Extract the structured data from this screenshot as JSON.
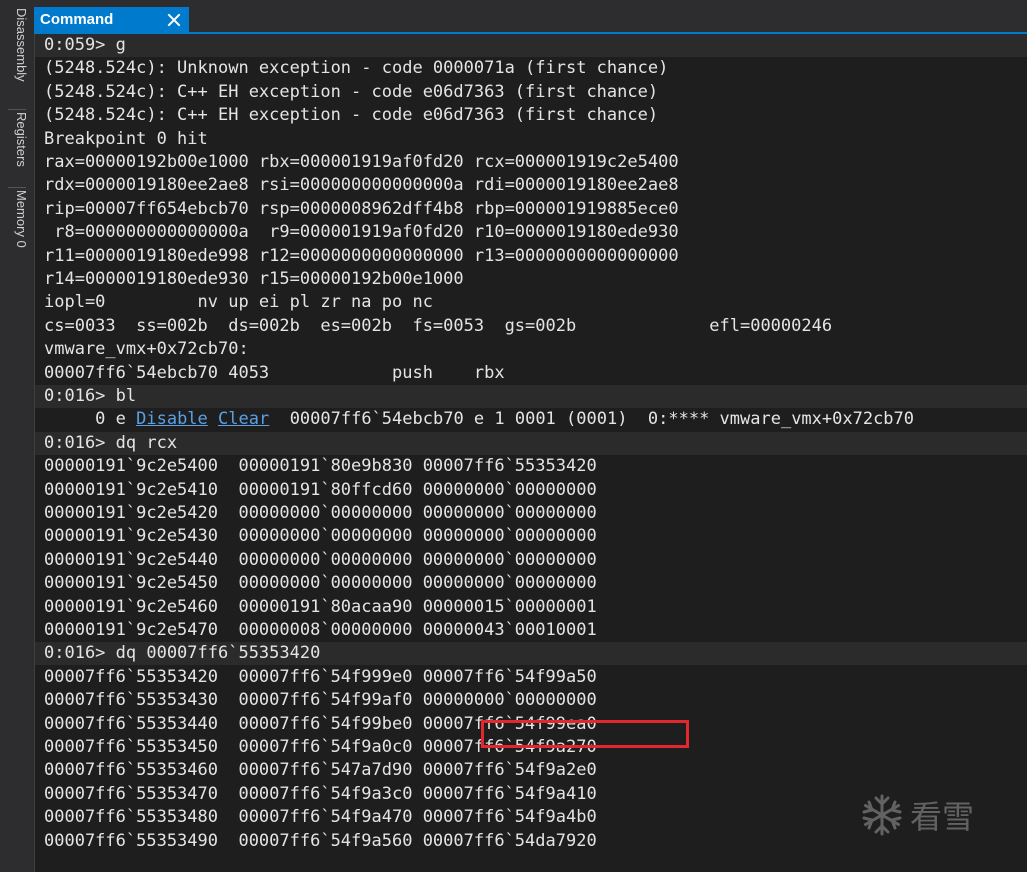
{
  "side_tabs": [
    "Disassembly",
    "Registers",
    "Memory 0"
  ],
  "window": {
    "tab_title": "Command"
  },
  "output": [
    "0:059> g",
    "(5248.524c): Unknown exception - code 0000071a (first chance)",
    "(5248.524c): C++ EH exception - code e06d7363 (first chance)",
    "(5248.524c): C++ EH exception - code e06d7363 (first chance)",
    "Breakpoint 0 hit",
    "rax=00000192b00e1000 rbx=000001919af0fd20 rcx=000001919c2e5400",
    "rdx=0000019180ee2ae8 rsi=000000000000000a rdi=0000019180ee2ae8",
    "rip=00007ff654ebcb70 rsp=0000008962dff4b8 rbp=000001919885ece0",
    " r8=000000000000000a  r9=000001919af0fd20 r10=0000019180ede930",
    "r11=0000019180ede998 r12=0000000000000000 r13=0000000000000000",
    "r14=0000019180ede930 r15=00000192b00e1000",
    "iopl=0         nv up ei pl zr na po nc",
    "cs=0033  ss=002b  ds=002b  es=002b  fs=0053  gs=002b             efl=00000246",
    "vmware_vmx+0x72cb70:",
    "00007ff6`54ebcb70 4053            push    rbx",
    "0:016> bl",
    null,
    "0:016> dq rcx",
    "00000191`9c2e5400  00000191`80e9b830 00007ff6`55353420",
    "00000191`9c2e5410  00000191`80ffcd60 00000000`00000000",
    "00000191`9c2e5420  00000000`00000000 00000000`00000000",
    "00000191`9c2e5430  00000000`00000000 00000000`00000000",
    "00000191`9c2e5440  00000000`00000000 00000000`00000000",
    "00000191`9c2e5450  00000000`00000000 00000000`00000000",
    "00000191`9c2e5460  00000191`80acaa90 00000015`00000001",
    "00000191`9c2e5470  00000008`00000000 00000043`00010001",
    "0:016> dq 00007ff6`55353420",
    "00007ff6`55353420  00007ff6`54f999e0 00007ff6`54f99a50",
    "00007ff6`55353430  00007ff6`54f99af0 00000000`00000000",
    "00007ff6`55353440  00007ff6`54f99be0 00007ff6`54f99ea0",
    "00007ff6`55353450  00007ff6`54f9a0c0 00007ff6`54f9a270",
    "00007ff6`55353460  00007ff6`547a7d90 00007ff6`54f9a2e0",
    "00007ff6`55353470  00007ff6`54f9a3c0 00007ff6`54f9a410",
    "00007ff6`55353480  00007ff6`54f9a470 00007ff6`54f9a4b0",
    "00007ff6`55353490  00007ff6`54f9a560 00007ff6`54da7920"
  ],
  "bl_line": {
    "prefix": "     0 e ",
    "disable_link": "Disable",
    "clear_link": "Clear",
    "suffix": "  00007ff6`54ebcb70 e 1 0001 (0001)  0:**** vmware_vmx+0x72cb70"
  },
  "watermark": {
    "text": "看雪",
    "icon": "snowflake-icon"
  },
  "colors": {
    "background": "#1e1e1e",
    "accent": "#007acc",
    "text": "#e4e4e4",
    "link": "#5aa0e8",
    "highlight": "#e0282e"
  }
}
